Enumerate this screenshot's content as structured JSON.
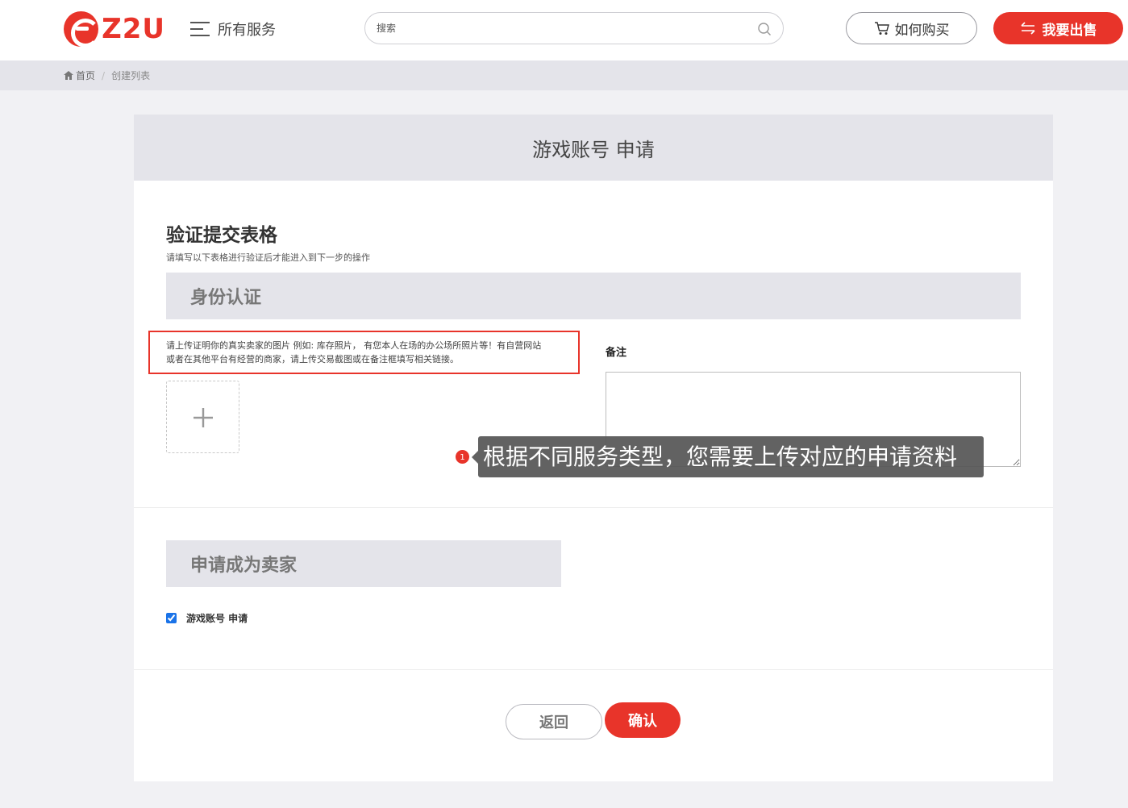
{
  "header": {
    "logo_text": "Z2U",
    "all_services_label": "所有服务",
    "search_placeholder": "搜索",
    "how_to_buy_label": "如何购买",
    "sell_label": "我要出售",
    "brand_color": "#e8342a"
  },
  "breadcrumb": {
    "home": "首页",
    "separator": "/",
    "current": "创建列表"
  },
  "card": {
    "title": "游戏账号 申请",
    "form_title": "验证提交表格",
    "form_subtitle": "请填写以下表格进行验证后才能进入到下一步的操作",
    "section_identity": "身份认证",
    "upload_hint_line1": "请上传证明你的真实卖家的图片 例如: 库存照片， 有您本人在场的办公场所照片等！有自营网站",
    "upload_hint_line2": "或者在其他平台有经营的商家，请上传交易截图或在备注框填写相关链接。",
    "remark_label": "备注",
    "remark_value": "",
    "section_seller": "申请成为卖家",
    "checkbox_label": "游戏账号 申请",
    "checkbox_checked": true,
    "back_label": "返回",
    "confirm_label": "确认"
  },
  "guide": {
    "step_number": "1",
    "tooltip_text": "根据不同服务类型，您需要上传对应的申请资料"
  }
}
